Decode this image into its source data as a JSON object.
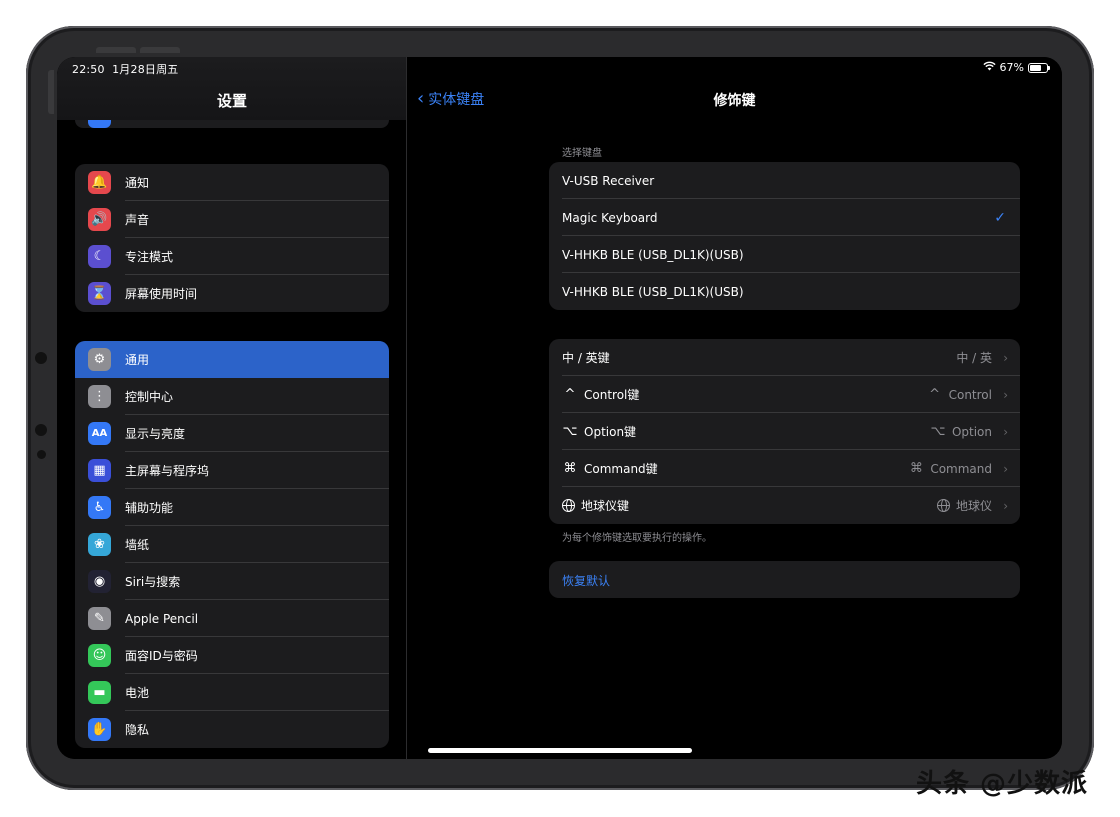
{
  "status": {
    "time": "22:50",
    "date": "1月28日周五",
    "battery": "67%",
    "battery_level": 0.67
  },
  "sidebar": {
    "title": "设置",
    "group1": [
      {
        "label": "通知",
        "icon": "bell-icon",
        "color": "#e5484d",
        "glyph": "🔔"
      },
      {
        "label": "声音",
        "icon": "speaker-icon",
        "color": "#e5484d",
        "glyph": "🔊"
      },
      {
        "label": "专注模式",
        "icon": "moon-icon",
        "color": "#5b4fd0",
        "glyph": "☾"
      },
      {
        "label": "屏幕使用时间",
        "icon": "hourglass-icon",
        "color": "#5b4fd0",
        "glyph": "⌛"
      }
    ],
    "group2": [
      {
        "label": "通用",
        "icon": "gear-icon",
        "color": "#8e8e93",
        "glyph": "⚙",
        "active": true
      },
      {
        "label": "控制中心",
        "icon": "toggles-icon",
        "color": "#8e8e93",
        "glyph": "⋮"
      },
      {
        "label": "显示与亮度",
        "icon": "text-size-icon",
        "color": "#3478f6",
        "glyph": "AA"
      },
      {
        "label": "主屏幕与程序坞",
        "icon": "grid-icon",
        "color": "#3a4fd8",
        "glyph": "▦"
      },
      {
        "label": "辅助功能",
        "icon": "accessibility-icon",
        "color": "#3478f6",
        "glyph": "♿"
      },
      {
        "label": "墙纸",
        "icon": "flower-icon",
        "color": "#35a7d8",
        "glyph": "❀"
      },
      {
        "label": "Siri与搜索",
        "icon": "siri-icon",
        "color": "#222233",
        "glyph": "◉"
      },
      {
        "label": "Apple Pencil",
        "icon": "pencil-icon",
        "color": "#8e8e93",
        "glyph": "✎"
      },
      {
        "label": "面容ID与密码",
        "icon": "faceid-icon",
        "color": "#34c759",
        "glyph": "☺"
      },
      {
        "label": "电池",
        "icon": "battery-icon",
        "color": "#34c759",
        "glyph": "▬"
      },
      {
        "label": "隐私",
        "icon": "hand-icon",
        "color": "#3478f6",
        "glyph": "✋"
      }
    ]
  },
  "detail": {
    "back_label": "实体键盘",
    "title": "修饰键",
    "keyboard_caption": "选择键盘",
    "keyboards": [
      {
        "label": "V-USB Receiver",
        "checked": false
      },
      {
        "label": "Magic Keyboard",
        "checked": true
      },
      {
        "label": "V-HHKB BLE (USB_DL1K)(USB)",
        "checked": false
      },
      {
        "label": "V-HHKB BLE (USB_DL1K)(USB)",
        "checked": false
      }
    ],
    "modifiers": [
      {
        "sym": "",
        "label": "中 / 英键",
        "value_sym": "",
        "value": "中 / 英"
      },
      {
        "sym": "^",
        "label": "Control键",
        "value_sym": "^",
        "value": "Control"
      },
      {
        "sym": "⌥",
        "label": "Option键",
        "value_sym": "⌥",
        "value": "Option"
      },
      {
        "sym": "⌘",
        "label": "Command键",
        "value_sym": "⌘",
        "value": "Command"
      },
      {
        "sym": "globe",
        "label": "地球仪键",
        "value_sym": "globe",
        "value": "地球仪"
      }
    ],
    "footer_note": "为每个修饰键选取要执行的操作。",
    "reset_label": "恢复默认"
  },
  "watermark": "头条 @少数派"
}
